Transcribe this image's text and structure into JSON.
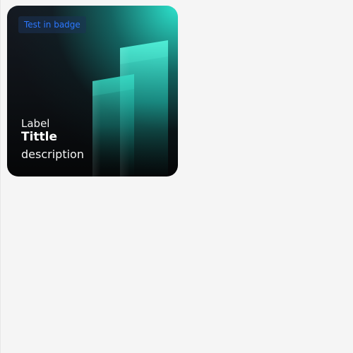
{
  "card": {
    "badge": "Test in badge",
    "label": "Label",
    "title": "Tittle",
    "description": "description"
  },
  "colors": {
    "page_background": "#f5f5f5",
    "card_dark": "#0d1014",
    "accent_teal": "#2eeed6",
    "badge_text": "#2c78ff"
  }
}
